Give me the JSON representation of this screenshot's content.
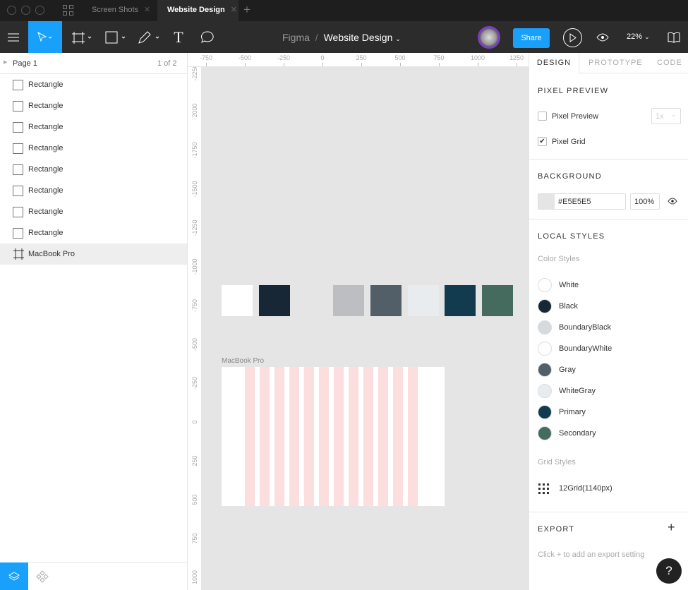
{
  "tabs": [
    {
      "label": "Screen Shots"
    },
    {
      "label": "Website Design"
    }
  ],
  "toolbar": {
    "breadcrumb_root": "Figma",
    "breadcrumb_sep": "/",
    "file_name": "Website Design",
    "share": "Share",
    "zoom": "22%"
  },
  "layers_panel": {
    "page": "Page 1",
    "page_count": "1 of 2",
    "layers": [
      {
        "name": "Rectangle"
      },
      {
        "name": "Rectangle"
      },
      {
        "name": "Rectangle"
      },
      {
        "name": "Rectangle"
      },
      {
        "name": "Rectangle"
      },
      {
        "name": "Rectangle"
      },
      {
        "name": "Rectangle"
      },
      {
        "name": "Rectangle"
      },
      {
        "name": "MacBook Pro",
        "selected": true
      }
    ]
  },
  "rulers": {
    "top": [
      "-750",
      "-500",
      "-250",
      "0",
      "250",
      "500",
      "750",
      "1000",
      "1250"
    ],
    "left": [
      "-2250",
      "-2000",
      "-1750",
      "-1500",
      "-1250",
      "-1000",
      "-750",
      "-500",
      "-250",
      "0",
      "250",
      "500",
      "750",
      "1000"
    ]
  },
  "canvas": {
    "swatches": [
      "#FFFFFF",
      "#172736",
      "#E5E5E5",
      "#BCBEC2",
      "#535F68",
      "#E8ECEF",
      "#123B4F",
      "#456B5F"
    ],
    "frame_label": "MacBook Pro",
    "grid_columns": 12,
    "grid_color": "#FCDEDE"
  },
  "design_panel": {
    "tabs": [
      "DESIGN",
      "PROTOTYPE",
      "CODE"
    ],
    "pixel_preview": {
      "title": "PIXEL PREVIEW",
      "preview_label": "Pixel Preview",
      "preview_checked": false,
      "scale": "1x",
      "grid_label": "Pixel Grid",
      "grid_checked": true
    },
    "background": {
      "title": "BACKGROUND",
      "hex": "#E5E5E5",
      "opacity": "100%"
    },
    "local_styles": {
      "title": "LOCAL STYLES",
      "color_styles_label": "Color Styles",
      "colors": [
        {
          "name": "White",
          "hex": "#FFFFFF"
        },
        {
          "name": "Black",
          "hex": "#172736"
        },
        {
          "name": "BoundaryBlack",
          "hex": "#D5DADD"
        },
        {
          "name": "BoundaryWhite",
          "hex": "#FFFFFF"
        },
        {
          "name": "Gray",
          "hex": "#535F68"
        },
        {
          "name": "WhiteGray",
          "hex": "#E8ECEF"
        },
        {
          "name": "Primary",
          "hex": "#123B4F"
        },
        {
          "name": "Secondary",
          "hex": "#456B5F"
        }
      ],
      "grid_styles_label": "Grid Styles",
      "grids": [
        {
          "name": "12Grid(1140px)"
        }
      ]
    },
    "export": {
      "title": "EXPORT",
      "hint": "Click + to add an export setting"
    }
  },
  "accent": "#18A0FB"
}
